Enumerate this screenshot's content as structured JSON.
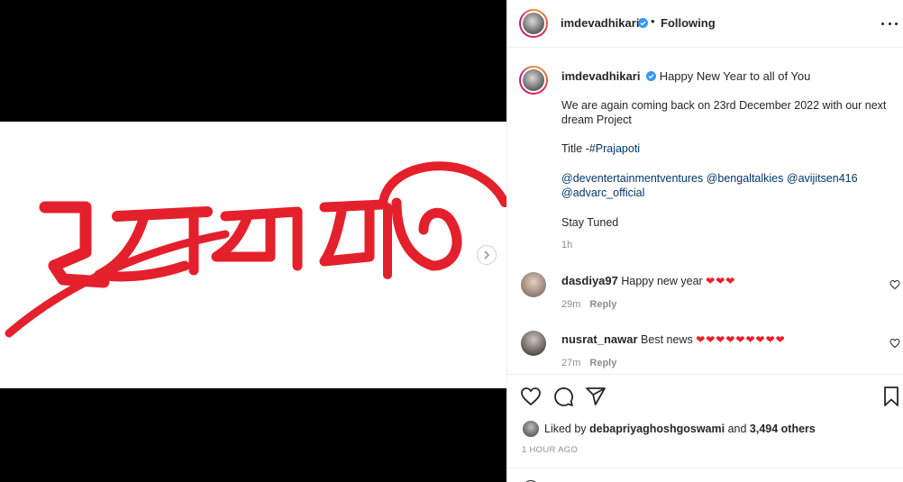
{
  "post": {
    "username": "imdevadhikari",
    "separator": "•",
    "follow_status": "Following",
    "caption_title": "Happy New Year to all of You",
    "caption_line1": "We are again coming back on 23rd December 2022 with our next dream Project",
    "caption_title_prefix": "Title -",
    "caption_hashtag": "#Prajapoti",
    "caption_mentions": [
      "@deventertainmentventures",
      "@bengaltalkies",
      "@avijitsen416",
      "@advarc_official"
    ],
    "caption_signoff": "Stay Tuned",
    "caption_time": "1h",
    "media_logo_text": "প্রজাপতি",
    "accent_color": "#e3202b"
  },
  "comments": [
    {
      "username": "dasdiya97",
      "text": "Happy new year",
      "hearts": "❤❤❤",
      "time": "29m",
      "reply_label": "Reply"
    },
    {
      "username": "nusrat_nawar",
      "text": "Best news",
      "hearts": "❤❤❤❤❤❤❤❤❤",
      "time": "27m",
      "reply_label": "Reply"
    }
  ],
  "actions": {
    "liked_by_prefix": "Liked by",
    "liked_by_user": "debapriyaghoshgoswami",
    "liked_by_and": "and",
    "liked_by_others": "3,494 others",
    "post_age": "1 HOUR AGO",
    "icons": [
      "heart-icon",
      "comment-icon",
      "share-icon",
      "bookmark-icon"
    ]
  }
}
